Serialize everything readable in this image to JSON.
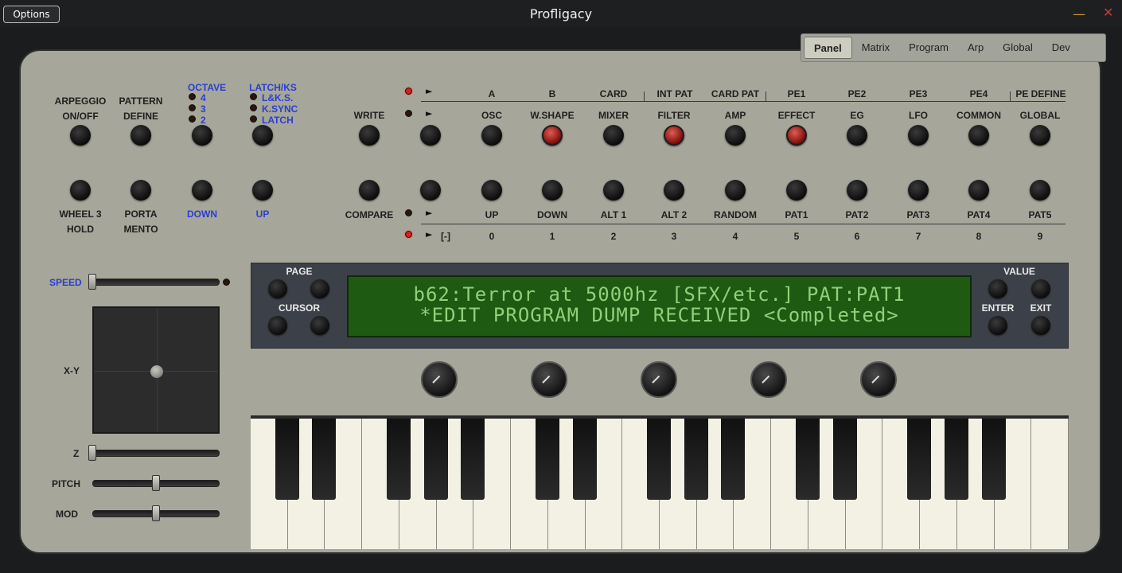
{
  "window": {
    "title": "Profligacy",
    "options_label": "Options",
    "minimize_glyph": "—",
    "close_glyph": "✕"
  },
  "tabs": [
    "Panel",
    "Matrix",
    "Program",
    "Arp",
    "Global",
    "Dev"
  ],
  "active_tab": "Panel",
  "left": {
    "arp_line1": "ARPEGGIO",
    "arp_line2": "ON/OFF",
    "pattern_line1": "PATTERN",
    "pattern_line2": "DEFINE",
    "octave": "OCTAVE",
    "octave_opts": [
      "4",
      "3",
      "2"
    ],
    "latch": "LATCH/KS",
    "latch_opts": [
      "L&K.S.",
      "K.SYNC",
      "LATCH"
    ],
    "wheel_line1": "WHEEL 3",
    "wheel_line2": "HOLD",
    "porta_line1": "PORTA",
    "porta_line2": "MENTO",
    "down": "DOWN",
    "up": "UP"
  },
  "mid": {
    "write": "WRITE",
    "compare": "COMPARE"
  },
  "top_headers": [
    "A",
    "B",
    "CARD",
    "INT PAT",
    "CARD PAT",
    "PE1",
    "PE2",
    "PE3",
    "PE4",
    "PE DEFINE"
  ],
  "top_buttons": [
    "OSC",
    "W.SHAPE",
    "MIXER",
    "FILTER",
    "AMP",
    "EFFECT",
    "EG",
    "LFO",
    "COMMON",
    "GLOBAL"
  ],
  "bottom_buttons": [
    "UP",
    "DOWN",
    "ALT 1",
    "ALT 2",
    "RANDOM",
    "PAT1",
    "PAT2",
    "PAT3",
    "PAT4",
    "PAT5"
  ],
  "bottom_numbers": [
    "0",
    "1",
    "2",
    "3",
    "4",
    "5",
    "6",
    "7",
    "8",
    "9"
  ],
  "bottom_bracket": "[-]",
  "display": {
    "page": "PAGE",
    "cursor": "CURSOR",
    "value": "VALUE",
    "enter": "ENTER",
    "exit": "EXIT",
    "line1": "b62:Terror at 5000hz [SFX/etc.] PAT:PAT1",
    "line2": "*EDIT PROGRAM DUMP RECEIVED  <Completed>"
  },
  "controls": {
    "speed": "SPEED",
    "xy": "X-Y",
    "z": "Z",
    "pitch": "PITCH",
    "mod": "MOD"
  },
  "colors": {
    "panel": "#a6a69a",
    "lcd": "#1e5a12",
    "lcd_text": "#8fd17a",
    "label_blue": "#2a3fd0",
    "led_on": "#e01c18"
  }
}
